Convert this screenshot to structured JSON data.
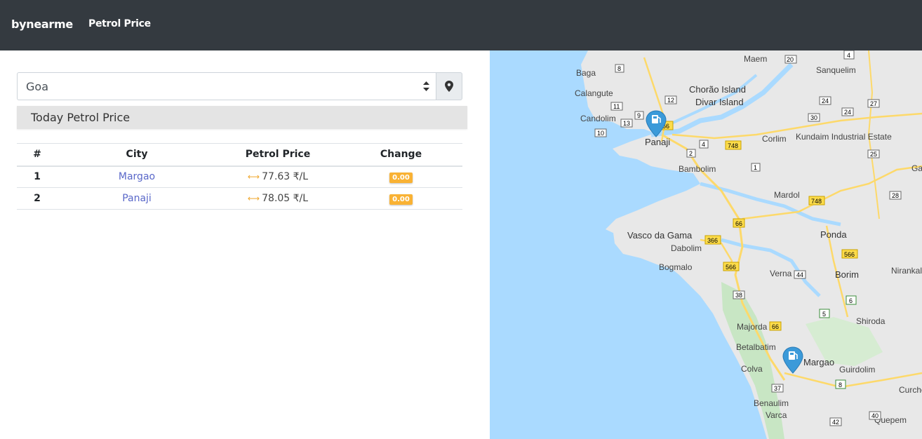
{
  "nav": {
    "brand": "bynearme",
    "link": "Petrol Price"
  },
  "filter": {
    "selected_state": "Goa",
    "location_icon": "map-marker-icon"
  },
  "section_title": "Today Petrol Price",
  "table": {
    "headers": [
      "#",
      "City",
      "Petrol Price",
      "Change"
    ],
    "rows": [
      {
        "index": "1",
        "city": "Margao",
        "price": "77.63 ₹/L",
        "change": "0.00"
      },
      {
        "index": "2",
        "city": "Panaji",
        "price": "78.05 ₹/L",
        "change": "0.00"
      }
    ]
  },
  "map": {
    "places": [
      "Maem",
      "Sanquelim",
      "Baga",
      "Calangute",
      "Chorão Island",
      "Divar Island",
      "Candolim",
      "Panaji",
      "Corlim",
      "Kundaim Industrial Estate",
      "Bambolim",
      "Mardol",
      "Ponda",
      "Vasco da Gama",
      "Dabolim",
      "Bogmalo",
      "Verna",
      "Borim",
      "Nirankal",
      "Shiroda",
      "Majorda",
      "Betalbatim",
      "Margao",
      "Colva",
      "Guirdolim",
      "Benaulim",
      "Varca",
      "Quepem",
      "Curche",
      "Ga"
    ],
    "road_numbers": [
      "4",
      "8",
      "20",
      "12",
      "11",
      "9",
      "13",
      "66",
      "10",
      "24",
      "30",
      "24",
      "27",
      "2",
      "4",
      "748",
      "1",
      "25",
      "748",
      "28",
      "66",
      "366",
      "566",
      "44",
      "566",
      "38",
      "5",
      "6",
      "66",
      "8",
      "37",
      "40",
      "42"
    ],
    "markers": [
      "Panaji",
      "Margao"
    ],
    "colors": {
      "water": "#aadaff",
      "land": "#e8e8e8",
      "green": "#c8e6c4",
      "road": "#fdd96a",
      "marker": "#3b9ad9"
    }
  }
}
